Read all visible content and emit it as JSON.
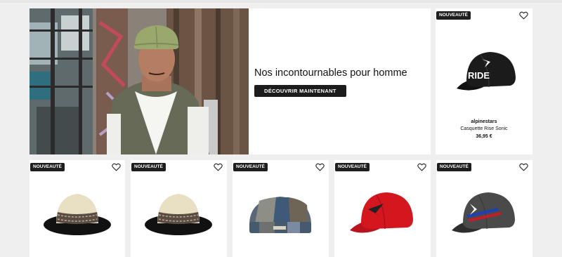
{
  "hero": {
    "title": "Nos incontournables pour homme",
    "button_label": "DÉCOUVRIR MAINTENANT"
  },
  "featured": {
    "badge": "NOUVEAUTÉ",
    "brand": "alpinestars",
    "name": "Casquette Rise Sonic",
    "price": "36,95 €",
    "cap_text": "RIDE"
  },
  "grid": [
    {
      "badge": "NOUVEAUTÉ",
      "icon": "straw-fedora-black-brim"
    },
    {
      "badge": "NOUVEAUTÉ",
      "icon": "straw-fedora-black-brim"
    },
    {
      "badge": "NOUVEAUTÉ",
      "icon": "patchwork-docker-hat"
    },
    {
      "badge": "NOUVEAUTÉ",
      "icon": "red-baseball-cap"
    },
    {
      "badge": "NOUVEAUTÉ",
      "icon": "grey-baseball-cap"
    }
  ]
}
